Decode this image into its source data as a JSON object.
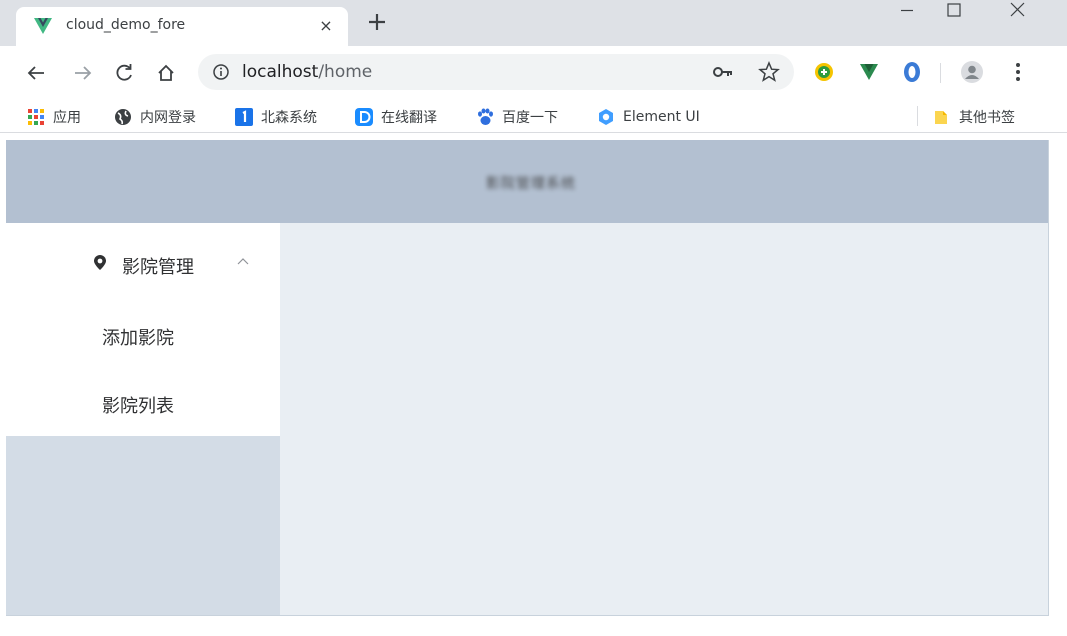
{
  "tab": {
    "title": "cloud_demo_fore",
    "close_glyph": "×",
    "favicon": "vue-logo-icon"
  },
  "window_controls": [
    "minimize-icon",
    "maximize-icon",
    "close-icon"
  ],
  "address_bar": {
    "host": "localhost",
    "path": "/home"
  },
  "bookmarks": [
    {
      "label": "应用",
      "icon": "apps-grid-icon"
    },
    {
      "label": "内网登录",
      "icon": "globe-icon"
    },
    {
      "label": "北森系统",
      "icon": "beisen-icon"
    },
    {
      "label": "在线翻译",
      "icon": "translate-icon"
    },
    {
      "label": "百度一下",
      "icon": "baidu-paw-icon"
    },
    {
      "label": "Element UI",
      "icon": "element-ui-icon"
    }
  ],
  "other_bookmarks": "其他书签",
  "app": {
    "header_title": "影院管理系统",
    "menu": {
      "submenu_title": "影院管理",
      "items": [
        "添加影院",
        "影院列表"
      ]
    }
  },
  "colors": {
    "header_bg": "#b3c0d1",
    "aside_bg": "#d3dce6",
    "main_bg": "#e9eef3",
    "tabstrip_bg": "#dee1e6"
  }
}
